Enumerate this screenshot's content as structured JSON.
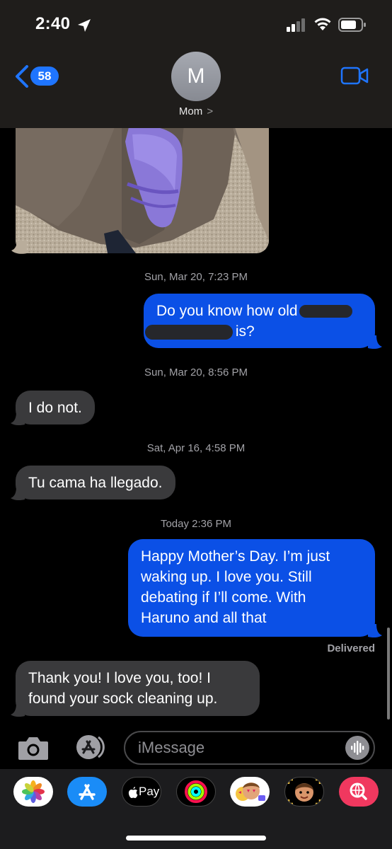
{
  "status_bar": {
    "time": "2:40"
  },
  "header": {
    "back_count": "58",
    "avatar_initial": "M",
    "contact_name": "Mom",
    "contact_chevron": ">"
  },
  "messages": {
    "ts1": {
      "day": "Sun, Mar 20,",
      "time": "7:23 PM"
    },
    "m1": {
      "line1": "Do you know how old",
      "line2_end": "is?"
    },
    "ts2": {
      "day": "Sun, Mar 20,",
      "time": "8:56 PM"
    },
    "m2": "I do not.",
    "ts3": {
      "day": "Sat, Apr 16,",
      "time": "4:58 PM"
    },
    "m3": "Tu cama ha llegado.",
    "ts4": {
      "day": "Today",
      "time": "2:36 PM"
    },
    "m4": [
      "Happy Mother’s Day. I’m just",
      "waking up. I love you. Still",
      "debating if I’ll come. With",
      "Haruno and all that"
    ],
    "delivered": "Delivered",
    "m5": [
      "Thank you! I love you, too! I",
      "found your sock cleaning up."
    ]
  },
  "input": {
    "placeholder": "iMessage"
  },
  "app_drawer": {
    "apple_pay_label": "Pay",
    "apps": [
      "photos-icon",
      "app-store-icon",
      "apple-pay-icon",
      "fitness-rings-icon",
      "memoji-stickers-icon",
      "memoji-icon",
      "web-search-icon"
    ]
  },
  "colors": {
    "outgoing_bubble": "#0b50e6",
    "incoming_bubble": "#3a3a3c",
    "accent": "#1f75ff",
    "background": "#000000"
  }
}
